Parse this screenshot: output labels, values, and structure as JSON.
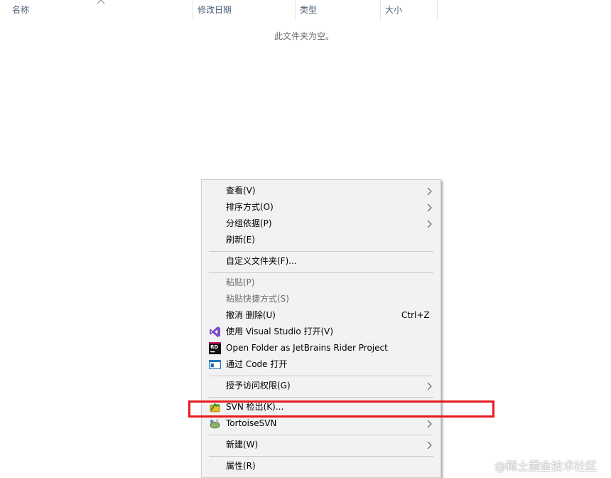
{
  "explorer": {
    "columns": [
      "名称",
      "修改日期",
      "类型",
      "大小"
    ],
    "empty_message": "此文件夹为空。"
  },
  "context_menu": {
    "items": [
      {
        "label": "查看(V)",
        "submenu": true
      },
      {
        "label": "排序方式(O)",
        "submenu": true
      },
      {
        "label": "分组依据(P)",
        "submenu": true
      },
      {
        "label": "刷新(E)"
      },
      {
        "label": "自定义文件夹(F)..."
      },
      {
        "label": "粘贴(P)",
        "disabled": true
      },
      {
        "label": "粘贴快捷方式(S)",
        "disabled": true
      },
      {
        "label": "撤消 删除(U)",
        "shortcut": "Ctrl+Z"
      },
      {
        "label": "使用 Visual Studio 打开(V)",
        "icon": "visual-studio-icon"
      },
      {
        "label": "Open Folder as JetBrains Rider Project",
        "icon": "jetbrains-rider-icon"
      },
      {
        "label": "通过 Code 打开",
        "icon": "vscode-icon"
      },
      {
        "label": "授予访问权限(G)",
        "submenu": true
      },
      {
        "label": "SVN 检出(K)...",
        "icon": "svn-checkout-icon"
      },
      {
        "label": "TortoiseSVN",
        "icon": "tortoisesvn-icon",
        "submenu": true
      },
      {
        "label": "新建(W)",
        "submenu": true
      },
      {
        "label": "属性(R)"
      }
    ]
  },
  "annotation": {
    "highlight_color": "#e8191d"
  },
  "watermark": "@稀土掘金技术社区"
}
